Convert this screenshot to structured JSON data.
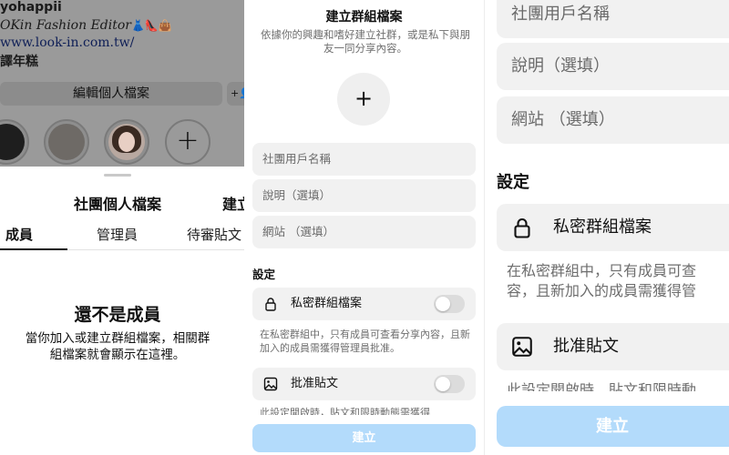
{
  "profile": {
    "username": "yohappii",
    "bio_line1": "OKin Fashion Editor",
    "bio_emoji": "👗👠👜",
    "link": "www.look-in.com.tw/",
    "bio_line3": "譯年糕",
    "edit_button": "編輯個人檔案",
    "add_button": "+1",
    "new_highlight": "+"
  },
  "community_sheet": {
    "title": "社團個人檔案",
    "create": "建立",
    "tabs": [
      "成員",
      "管理員",
      "待審貼文"
    ],
    "empty_title": "還不是成員",
    "empty_desc": "當你加入或建立群組檔案，相關群組檔案就會顯示在這裡。"
  },
  "create_group": {
    "title": "建立群組檔案",
    "subtitle": "依據你的興趣和嗜好建立社群，或是私下與朋友一同分享內容。",
    "avatar_plus": "+",
    "fields": {
      "username_placeholder": "社團用戶名稱",
      "description_placeholder": "說明（選填）",
      "website_placeholder": "網站 （選填）"
    },
    "settings_label": "設定",
    "private": {
      "label": "私密群組檔案",
      "enabled": false,
      "desc": "在私密群組中，只有成員可查看分享內容，且新加入的成員需獲得管理員批准。"
    },
    "approve_posts": {
      "label": "批准貼文",
      "enabled": false,
      "desc": "此設定開啟時，貼文和限時動態需獲得"
    },
    "create_button": "建立"
  },
  "zoom": {
    "fields": [
      "社團用戶名稱",
      "說明（選填）",
      "網站 （選填）"
    ],
    "settings_label": "設定",
    "private_label": "私密群組檔案",
    "private_desc_line1": "在私密群組中，只有成員可查",
    "private_desc_line2": "容，且新加入的成員需獲得管",
    "approve_label": "批准貼文",
    "approve_desc": "此設定開啟時，貼文和限時動",
    "create_button": "建立"
  },
  "colors": {
    "create_button_bg": "#b3dbfb",
    "field_bg": "#f1f1f1",
    "dim_overlay": "#9a9a9a"
  }
}
